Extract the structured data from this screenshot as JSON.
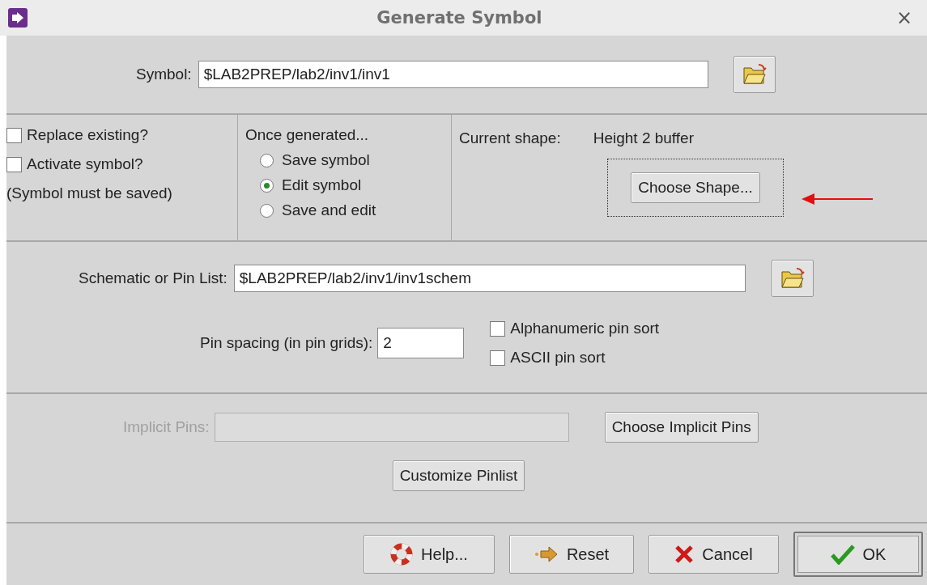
{
  "window": {
    "title": "Generate Symbol",
    "close": "×"
  },
  "symbol": {
    "label": "Symbol:",
    "value": "$LAB2PREP/lab2/inv1/inv1"
  },
  "options": {
    "checkboxes": [
      {
        "label": "Replace existing?",
        "checked": false
      },
      {
        "label": "Activate symbol?",
        "checked": false
      }
    ],
    "note": "(Symbol must be saved)",
    "once_generated": {
      "label": "Once generated...",
      "choices": [
        {
          "label": "Save symbol",
          "selected": false
        },
        {
          "label": "Edit symbol",
          "selected": true
        },
        {
          "label": "Save and edit",
          "selected": false
        }
      ]
    },
    "shape": {
      "label": "Current shape:",
      "value": "Height 2 buffer",
      "button": "Choose Shape...",
      "focused": true
    }
  },
  "schematic": {
    "label": "Schematic or Pin List:",
    "value": "$LAB2PREP/lab2/inv1/inv1schem"
  },
  "pin_spacing": {
    "label": "Pin spacing (in pin grids):",
    "value": "2"
  },
  "sort": [
    {
      "label": "Alphanumeric pin sort",
      "checked": false
    },
    {
      "label": "ASCII pin sort",
      "checked": false
    }
  ],
  "implicit_pins": {
    "label": "Implicit Pins:",
    "disabled": true,
    "button": "Choose Implicit Pins"
  },
  "customize": {
    "button": "Customize Pinlist"
  },
  "buttons": [
    {
      "label": "Help...",
      "kind": "help",
      "default": false
    },
    {
      "label": "Reset",
      "kind": "reset",
      "default": false
    },
    {
      "label": "Cancel",
      "kind": "cancel",
      "default": false
    },
    {
      "label": "OK",
      "kind": "ok",
      "default": true
    }
  ]
}
